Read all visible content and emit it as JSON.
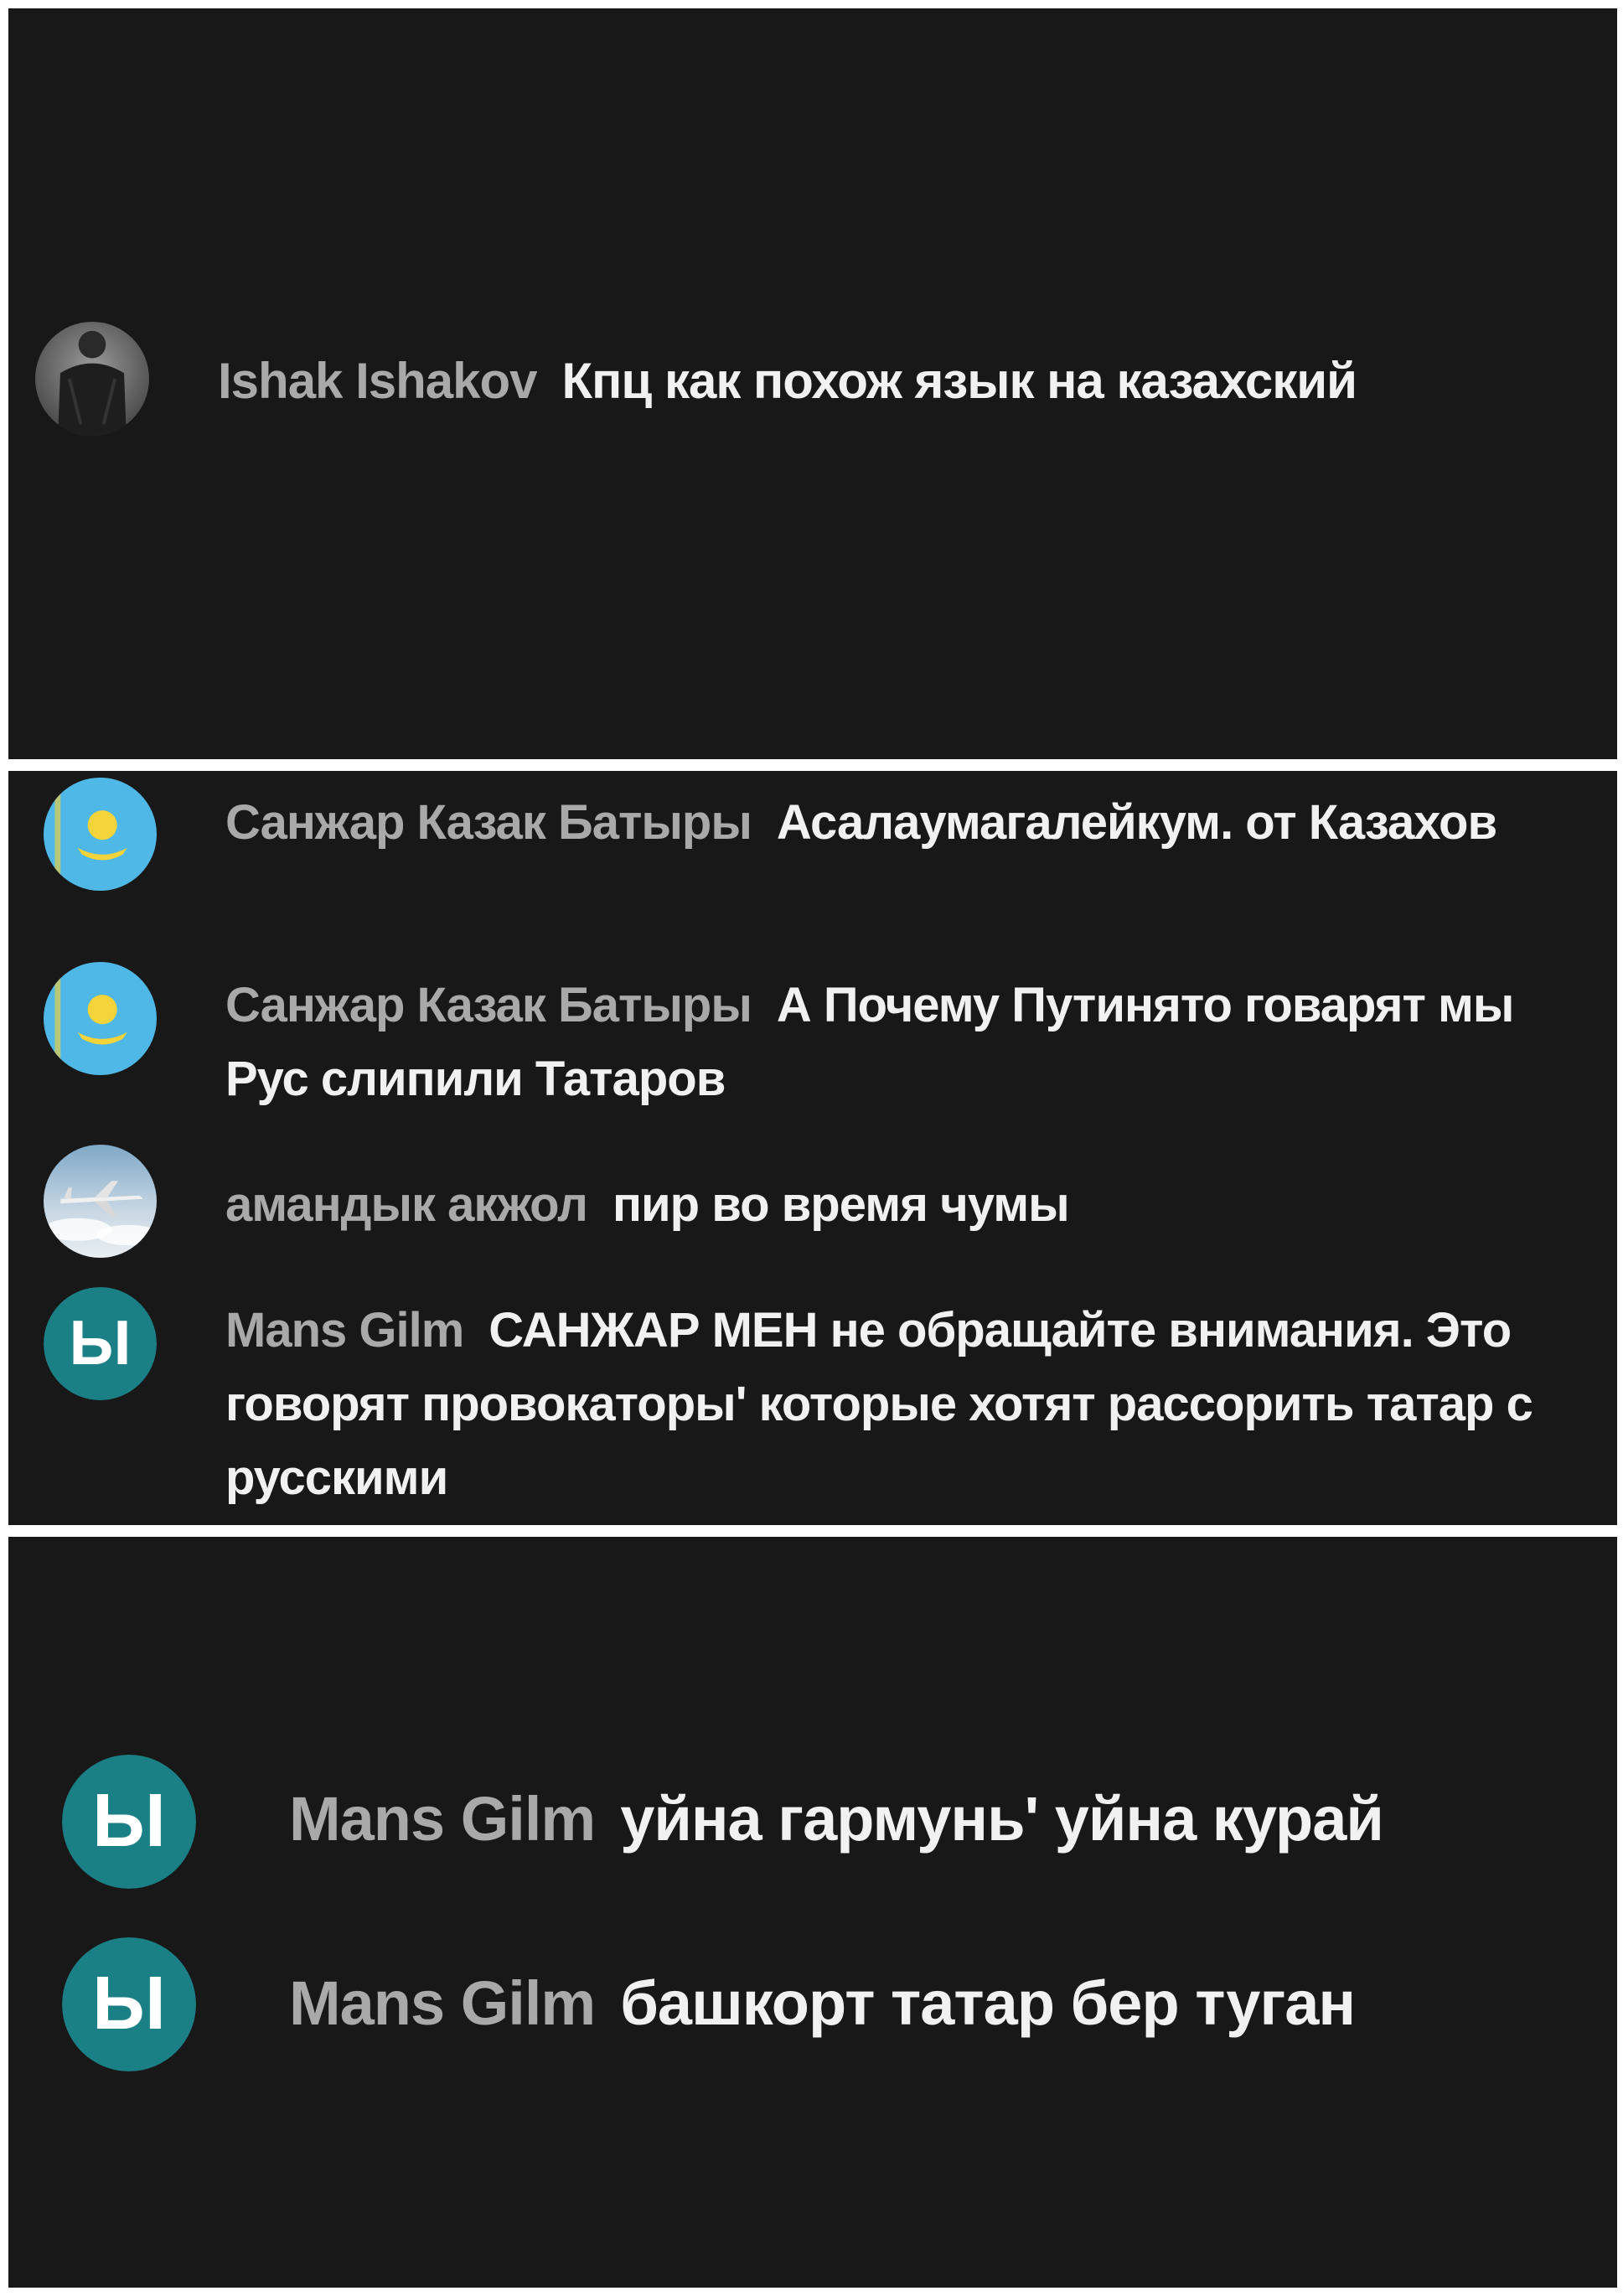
{
  "panels": [
    {
      "comments": [
        {
          "author": "Ishak Ishakov",
          "text": "Кпц как похож язык на казахский",
          "avatar_icon": "photo-avatar-icon"
        }
      ]
    },
    {
      "comments": [
        {
          "author": "Санжар Казак Батыры",
          "text": "Асалаумагалейкум. от Казахов",
          "avatar_icon": "kazakhstan-flag-avatar-icon"
        },
        {
          "author": "Санжар Казак Батыры",
          "text": "А Почему Путинято говарят мы Рус слипили Татаров",
          "avatar_icon": "kazakhstan-flag-avatar-icon"
        },
        {
          "author": "амандык акжол",
          "text": "пир во время чумы",
          "avatar_icon": "airplane-avatar-icon"
        },
        {
          "author": "Mans Gilm",
          "text": "САНЖАР МЕН не обращайте внимания. Это говорят провокаторы' которые хотят рассорить татар с русскими",
          "avatar_icon": "letter-avatar-icon",
          "avatar_letter": "Ы"
        }
      ]
    },
    {
      "comments": [
        {
          "author": "Mans Gilm",
          "text": "уйна гармунь' уйна курай",
          "avatar_icon": "letter-avatar-icon",
          "avatar_letter": "Ы"
        },
        {
          "author": "Mans Gilm",
          "text": "башкорт татар бер туган",
          "avatar_icon": "letter-avatar-icon",
          "avatar_letter": "Ы"
        }
      ]
    }
  ],
  "colors": {
    "background": "#181818",
    "author": "#a9a9a9",
    "text": "#f1f1f1",
    "letter_avatar_bg": "#1b7f86",
    "flag_blue": "#4fb8e6",
    "flag_gold": "#f5d33a"
  }
}
